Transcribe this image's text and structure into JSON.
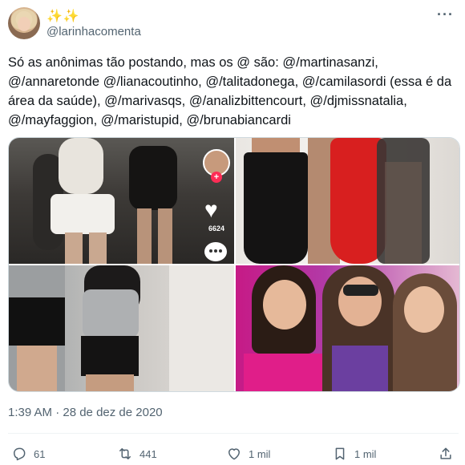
{
  "author": {
    "display_name": "✨✨",
    "handle": "@larinhacomenta"
  },
  "tweet": {
    "text": "Só as anônimas tão postando, mas os @ são: @/martinasanzi, @/annaretonde @/lianacoutinho, @/talitadonega, @/camilasordi (essa é da área da saúde), @/marivasqs, @/analizbittencourt, @/djmissnatalia, @/mayfaggion, @/maristupid, @/brunabiancardi",
    "timestamp": "1:39 AM · 28 de dez de 2020"
  },
  "media": {
    "tiktok_like_count": "6624",
    "tiktok_follow_symbol": "+"
  },
  "actions": {
    "replies": "61",
    "retweets": "441",
    "likes": "1 mil",
    "bookmarks": "1 mil"
  },
  "menu": {
    "more_symbol": "···"
  },
  "colors": {
    "text": "#0f1419",
    "secondary": "#536471",
    "border": "#cfd9de",
    "sparkle": "#f0b400"
  }
}
